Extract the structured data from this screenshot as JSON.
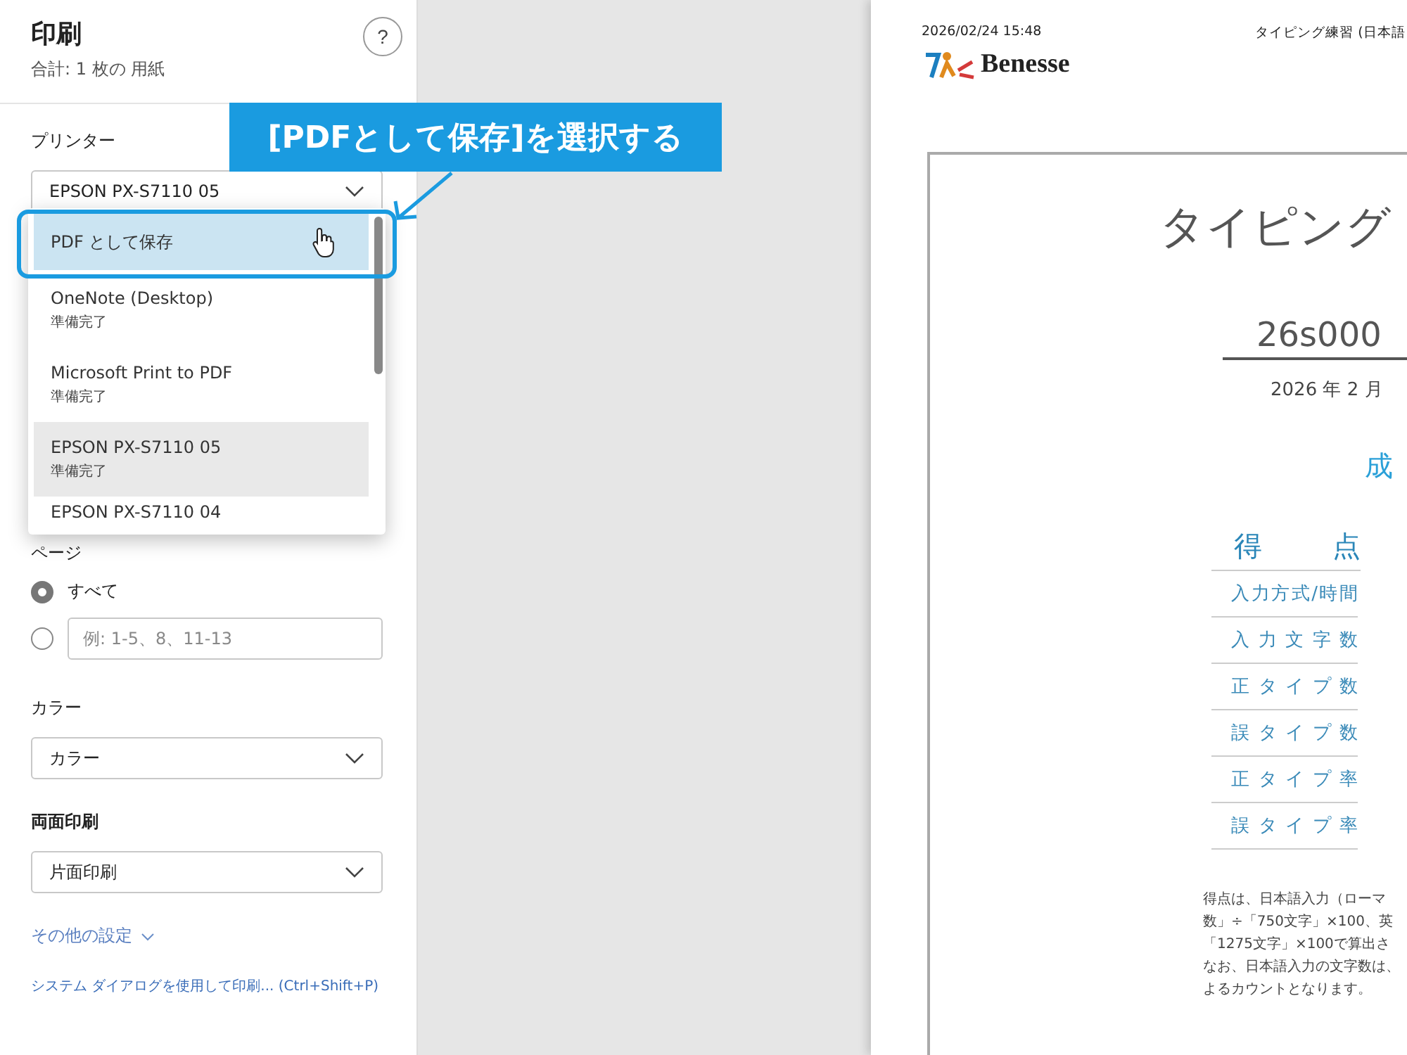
{
  "print_panel": {
    "title": "印刷",
    "subtitle": "合計: 1 枚の 用紙",
    "help_button": "?",
    "printer": {
      "label": "プリンター",
      "value": "EPSON PX-S7110 05",
      "expanded": true,
      "options": [
        {
          "name": "PDF として保存",
          "hovered": true,
          "selected": false
        },
        {
          "name": "OneNote (Desktop)",
          "status": "準備完了",
          "hovered": false,
          "selected": false
        },
        {
          "name": "Microsoft Print to PDF",
          "status": "準備完了",
          "hovered": false,
          "selected": false
        },
        {
          "name": "EPSON PX-S7110 05",
          "status": "準備完了",
          "hovered": false,
          "selected": true
        },
        {
          "name": "EPSON PX-S7110 04",
          "hovered": false,
          "selected": false
        }
      ]
    },
    "pages": {
      "label": "ページ",
      "options": [
        {
          "kind": "label",
          "label": "すべて",
          "selected": true
        },
        {
          "kind": "range",
          "placeholder": "例: 1-5、8、11-13",
          "selected": false
        }
      ]
    },
    "color": {
      "label": "カラー",
      "value": "カラー"
    },
    "duplex": {
      "label": "両面印刷",
      "value": "片面印刷"
    },
    "more_settings": {
      "label": "その他の設定",
      "expanded": false
    },
    "system_dialog_link": "システム ダイアログを使用して印刷... (Ctrl+Shift+P)"
  },
  "callout": {
    "text": "[PDFとして保存]を選択する"
  },
  "preview": {
    "header_date": "2026/02/24 15:48",
    "header_title": "タイピング練習 (日本語",
    "logo_text": "Benesse",
    "heading": "タイピング",
    "name": "26s000",
    "date": "2026 年 2 月",
    "section_title": "成",
    "table_header": "得点",
    "rows": [
      "入力方式/時間",
      "入力文字数",
      "正タイプ数",
      "誤タイプ数",
      "正タイプ率",
      "誤タイプ率"
    ],
    "note_lines": [
      "得点は、日本語入力（ローマ",
      "数」÷「750文字」×100、英",
      "「1275文字」×100で算出さ",
      "なお、日本語入力の文字数は、",
      "よるカウントとなります。"
    ]
  }
}
